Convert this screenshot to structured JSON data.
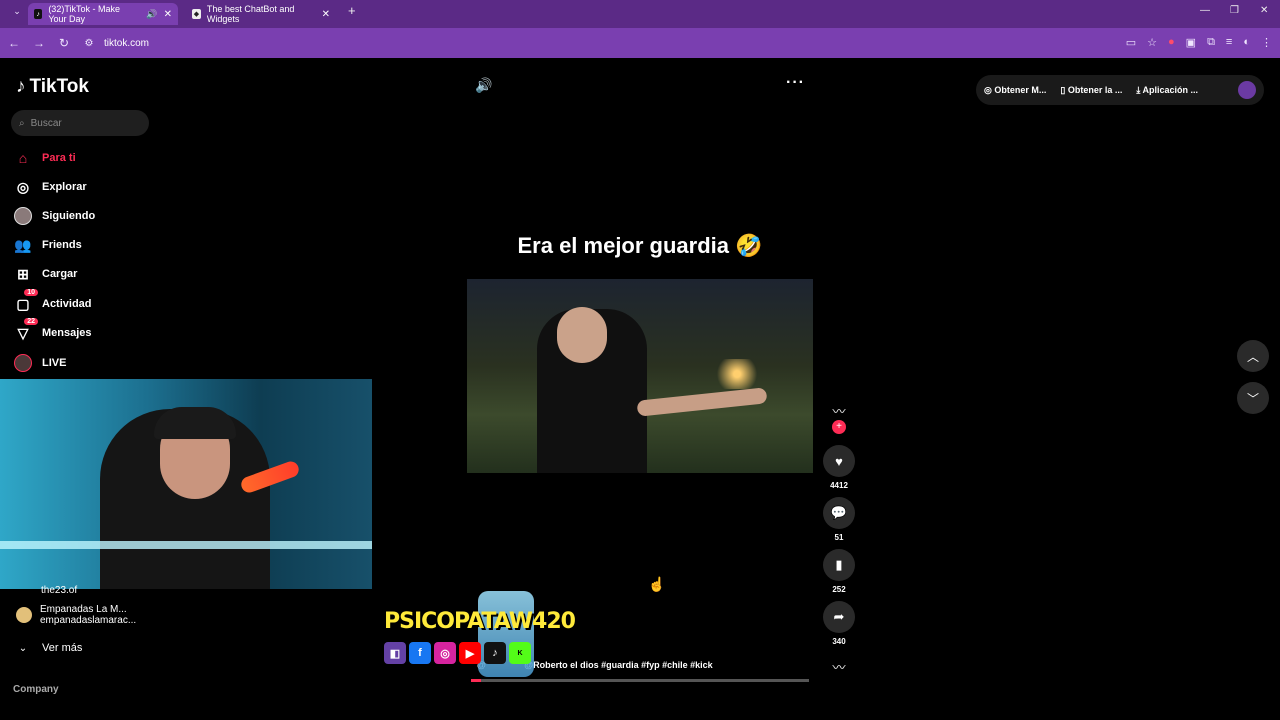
{
  "browser": {
    "tabs": [
      {
        "label": "(32)TikTok - Make Your Day",
        "active": true
      },
      {
        "label": "The best ChatBot and Widgets",
        "active": false
      }
    ],
    "url": "tiktok.com"
  },
  "sidebar": {
    "logo": "TikTok",
    "search_placeholder": "Buscar",
    "items": [
      {
        "label": "Para ti",
        "icon": "home-icon"
      },
      {
        "label": "Explorar",
        "icon": "compass-icon"
      },
      {
        "label": "Siguiendo",
        "icon": "avatar-icon"
      },
      {
        "label": "Friends",
        "icon": "friends-icon"
      },
      {
        "label": "Cargar",
        "icon": "upload-icon"
      },
      {
        "label": "Actividad",
        "icon": "activity-icon",
        "badge": "10"
      },
      {
        "label": "Mensajes",
        "icon": "messages-icon",
        "badge": "22"
      },
      {
        "label": "LIVE",
        "icon": "live-icon"
      }
    ],
    "following": [
      {
        "name": "the23.of",
        "handle": ""
      },
      {
        "name": "Empanadas La M...",
        "handle": "empanadaslamarac..."
      }
    ],
    "see_more": "Ver más",
    "company": "Company"
  },
  "video": {
    "caption_title": "Era el mejor guardia 🤣",
    "hashtags": "@Roberto el dios #guardia #fyp #chile #kick",
    "overlay_brand": "PSICOPATAW420",
    "likes": "4412",
    "comments": "51",
    "saves": "252",
    "shares": "340",
    "progress": 0.03
  },
  "topbar": {
    "items": [
      "Obtener M...",
      "Obtener la ...",
      "Aplicación ..."
    ]
  }
}
